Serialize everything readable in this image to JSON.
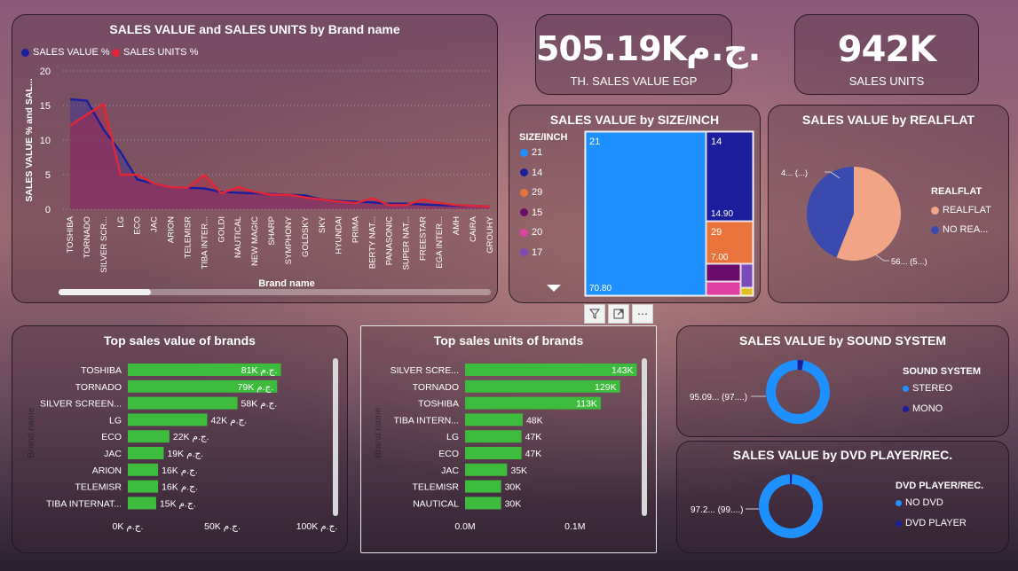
{
  "colors": {
    "green": "#3dbb3d",
    "navy": "#1b1f9e",
    "red": "#e32636",
    "lightblue": "#1e90ff",
    "orange": "#e8743b",
    "salmon": "#f2a586"
  },
  "kpis": [
    {
      "value": "505.19Kج.م.",
      "label": "TH. SALES VALUE EGP"
    },
    {
      "value": "942K",
      "label": "SALES UNITS"
    }
  ],
  "line_title": "SALES VALUE and SALES UNITS by Brand name",
  "treemap_title": "SALES VALUE by SIZE/INCH",
  "pie_title": "SALES VALUE by REALFLAT",
  "topvalue_title": "Top sales value of brands",
  "topunits_title": "Top sales units of brands",
  "sound_title": "SALES VALUE by SOUND SYSTEM",
  "dvd_title": "SALES VALUE by DVD PLAYER/REC.",
  "chart_data": [
    {
      "type": "area",
      "title": "SALES VALUE and SALES UNITS by Brand name",
      "xlabel": "Brand name",
      "ylabel": "SALES VALUE % and SAL...",
      "ylim": [
        0,
        20
      ],
      "yticks": [
        "0",
        "5",
        "10",
        "15",
        "20"
      ],
      "categories": [
        "TOSHIBA",
        "TORNADO",
        "SILVER SCR...",
        "LG",
        "ECO",
        "JAC",
        "ARION",
        "TELEMISR",
        "TIBA INTER...",
        "GOLDI",
        "NAUTICAL",
        "NEW MAGIC",
        "SHARP",
        "SYMPHONY",
        "GOLDSKY",
        "SKY",
        "HYUNDAI",
        "PRIMA",
        "BERTY NAT...",
        "PANASONIC",
        "SUPER NAT...",
        "FREESTAR",
        "EGA INTER...",
        "AMH",
        "CAIRA",
        "GROUHY"
      ],
      "series": [
        {
          "name": "SALES VALUE %",
          "color": "#1b1f9e",
          "values": [
            15.9,
            15.7,
            11.5,
            8.3,
            4.3,
            3.7,
            3.2,
            3.1,
            3.0,
            2.5,
            2.4,
            2.3,
            2.2,
            2.1,
            2.0,
            1.4,
            1.2,
            1.1,
            1.0,
            0.8,
            0.8,
            0.7,
            0.6,
            0.5,
            0.5,
            0.4
          ]
        },
        {
          "name": "SALES UNITS %",
          "color": "#e32636",
          "values": [
            12.1,
            13.7,
            15.2,
            5.0,
            5.0,
            3.7,
            3.2,
            3.1,
            5.0,
            2.3,
            3.2,
            2.5,
            2.1,
            2.1,
            1.7,
            1.4,
            1.1,
            0.9,
            1.6,
            0.6,
            0.6,
            1.4,
            0.9,
            0.6,
            0.5,
            0.4
          ]
        }
      ]
    },
    {
      "type": "treemap",
      "title": "SALES VALUE by SIZE/INCH",
      "legend_title": "SIZE/INCH",
      "legend": [
        {
          "name": "21",
          "color": "#1e90ff"
        },
        {
          "name": "14",
          "color": "#1b1f9e"
        },
        {
          "name": "29",
          "color": "#e8743b"
        },
        {
          "name": "15",
          "color": "#6a0d6a"
        },
        {
          "name": "20",
          "color": "#e040a0"
        },
        {
          "name": "17",
          "color": "#7a4ab8"
        }
      ],
      "labels": [
        {
          "name": "21",
          "value": "70.80"
        },
        {
          "name": "14",
          "value": "14.90"
        },
        {
          "name": "29",
          "value": "7.00"
        }
      ]
    },
    {
      "type": "pie",
      "title": "SALES VALUE by REALFLAT",
      "legend_title": "REALFLAT",
      "slices": [
        {
          "name": "REALFLAT",
          "value": 56,
          "color": "#f2a586",
          "label": "56... (5...)"
        },
        {
          "name": "NO REA...",
          "value": 44,
          "color": "#3a4aae",
          "label": "4... (...)"
        }
      ]
    },
    {
      "type": "bar",
      "title": "Top sales value of brands",
      "ylabel": "Brand name",
      "categories": [
        "TOSHIBA",
        "TORNADO",
        "SILVER SCREEN...",
        "LG",
        "ECO",
        "JAC",
        "ARION",
        "TELEMISR",
        "TIBA INTERNAT..."
      ],
      "values": [
        81,
        79,
        58,
        42,
        22,
        19,
        16,
        16,
        15
      ],
      "value_labels": [
        "81K ج.م.",
        "79K ج.م.",
        "58K ج.م.",
        "42K ج.م.",
        "22K ج.م.",
        "19K ج.م.",
        "16K ج.م.",
        "16K ج.م.",
        "15K ج.م."
      ],
      "xticks": [
        "0K ج.م.",
        "50K ج.م.",
        "100K ج.م."
      ],
      "xlim": [
        0,
        100
      ]
    },
    {
      "type": "bar",
      "title": "Top sales units of brands",
      "ylabel": "Brand name",
      "categories": [
        "SILVER SCRE...",
        "TORNADO",
        "TOSHIBA",
        "TIBA INTERN...",
        "LG",
        "ECO",
        "JAC",
        "TELEMISR",
        "NAUTICAL"
      ],
      "values": [
        143,
        129,
        113,
        48,
        47,
        47,
        35,
        30,
        30
      ],
      "value_labels": [
        "143K",
        "129K",
        "113K",
        "48K",
        "47K",
        "47K",
        "35K",
        "30K",
        "30K"
      ],
      "xticks": [
        "0.0M",
        "0.1M"
      ],
      "xlim": [
        0,
        150
      ]
    },
    {
      "type": "pie",
      "title": "SALES VALUE by SOUND SYSTEM",
      "legend_title": "SOUND SYSTEM",
      "slices": [
        {
          "name": "STEREO",
          "value": 97,
          "color": "#1e90ff",
          "label": "95.09... (97....)"
        },
        {
          "name": "MONO",
          "value": 3,
          "color": "#1b1f9e",
          "label": ""
        }
      ]
    },
    {
      "type": "pie",
      "title": "SALES VALUE by DVD PLAYER/REC.",
      "legend_title": "DVD PLAYER/REC.",
      "slices": [
        {
          "name": "NO DVD",
          "value": 99,
          "color": "#1e90ff",
          "label": "97.2... (99....)"
        },
        {
          "name": "DVD PLAYER",
          "value": 1,
          "color": "#1b1f9e",
          "label": ""
        }
      ]
    }
  ]
}
